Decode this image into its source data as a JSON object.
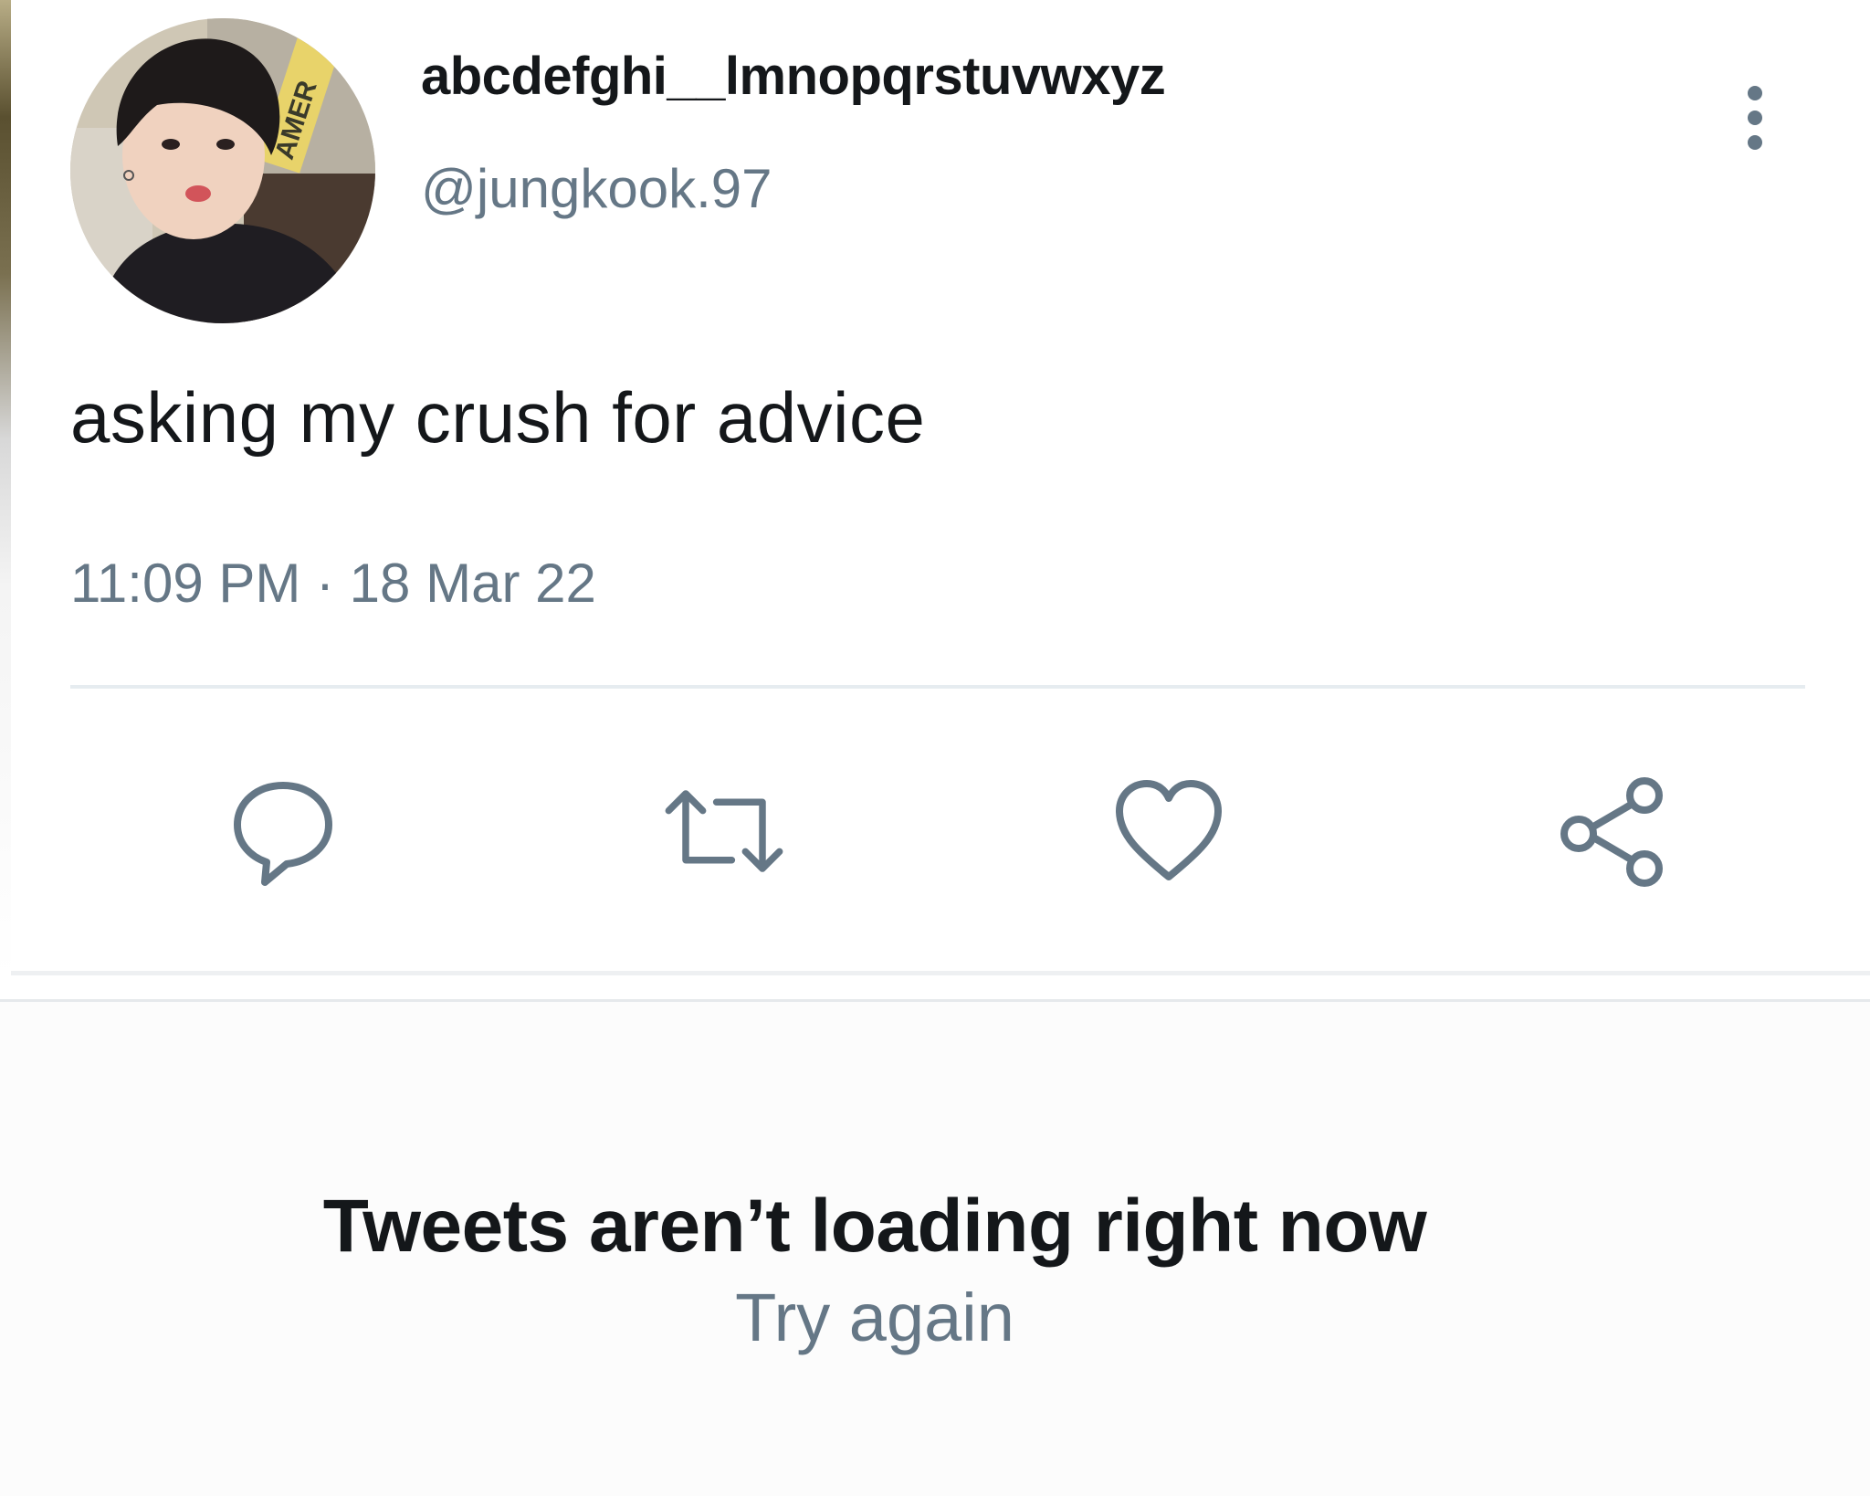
{
  "tweet": {
    "display_name": "abcdefghi__lmnopqrstuvwxyz",
    "handle": "@jungkook.97",
    "text": "asking my crush for advice",
    "timestamp": "11:09 PM · 18 Mar 22",
    "avatar_icon": "user-avatar-photo",
    "avatar_sign_text": "AMER"
  },
  "actions": [
    {
      "name": "reply",
      "icon": "reply-icon"
    },
    {
      "name": "retweet",
      "icon": "retweet-icon"
    },
    {
      "name": "like",
      "icon": "heart-icon"
    },
    {
      "name": "share",
      "icon": "share-icon"
    }
  ],
  "more_icon": "more-vertical-icon",
  "error": {
    "title": "Tweets aren’t loading right now",
    "retry_label": "Try again"
  },
  "colors": {
    "text_primary": "#14171a",
    "text_secondary": "#657786",
    "icon": "#657786",
    "divider": "#e6ecf0"
  }
}
